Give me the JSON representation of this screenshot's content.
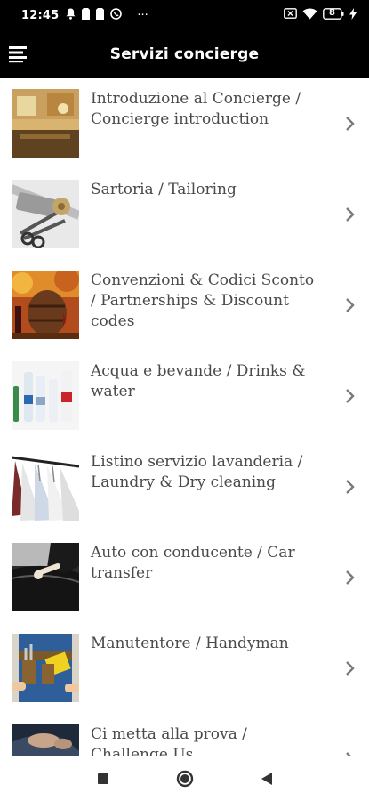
{
  "status_bar": {
    "time": "12:45",
    "icons": [
      "bell-icon",
      "sim-icon",
      "sim-icon",
      "whatsapp-icon",
      "more-dots-icon"
    ],
    "more": "···",
    "right_icons": [
      "no-sim-icon",
      "wifi-icon",
      "battery-icon",
      "charging-icon"
    ],
    "battery": "8"
  },
  "app_bar": {
    "title": "Servizi concierge",
    "menu_icon": "menu-icon"
  },
  "list": {
    "items": [
      {
        "label": "Introduzione al Concierge / Concierge introduction",
        "thumb": "hotel-lobby"
      },
      {
        "label": "Sartoria / Tailoring",
        "thumb": "scissors-thread"
      },
      {
        "label": "Convenzioni & Codici Sconto / Partnerships & Discount codes",
        "thumb": "wine-barrel"
      },
      {
        "label": "Acqua e bevande / Drinks & water",
        "thumb": "bottles"
      },
      {
        "label": "Listino servizio lavanderia / Laundry & Dry cleaning",
        "thumb": "shirts-hangers"
      },
      {
        "label": "Auto con conducente / Car transfer",
        "thumb": "car-door"
      },
      {
        "label": "Manutentore / Handyman",
        "thumb": "tool-belt"
      },
      {
        "label": "Ci metta alla prova / Challenge Us",
        "thumb": "hands"
      }
    ]
  },
  "nav_bar": {
    "buttons": [
      "recent-apps",
      "home",
      "back"
    ]
  },
  "colors": {
    "bar": "#000000",
    "text": "#4a4a4a",
    "chevron": "#7a7a7a"
  }
}
